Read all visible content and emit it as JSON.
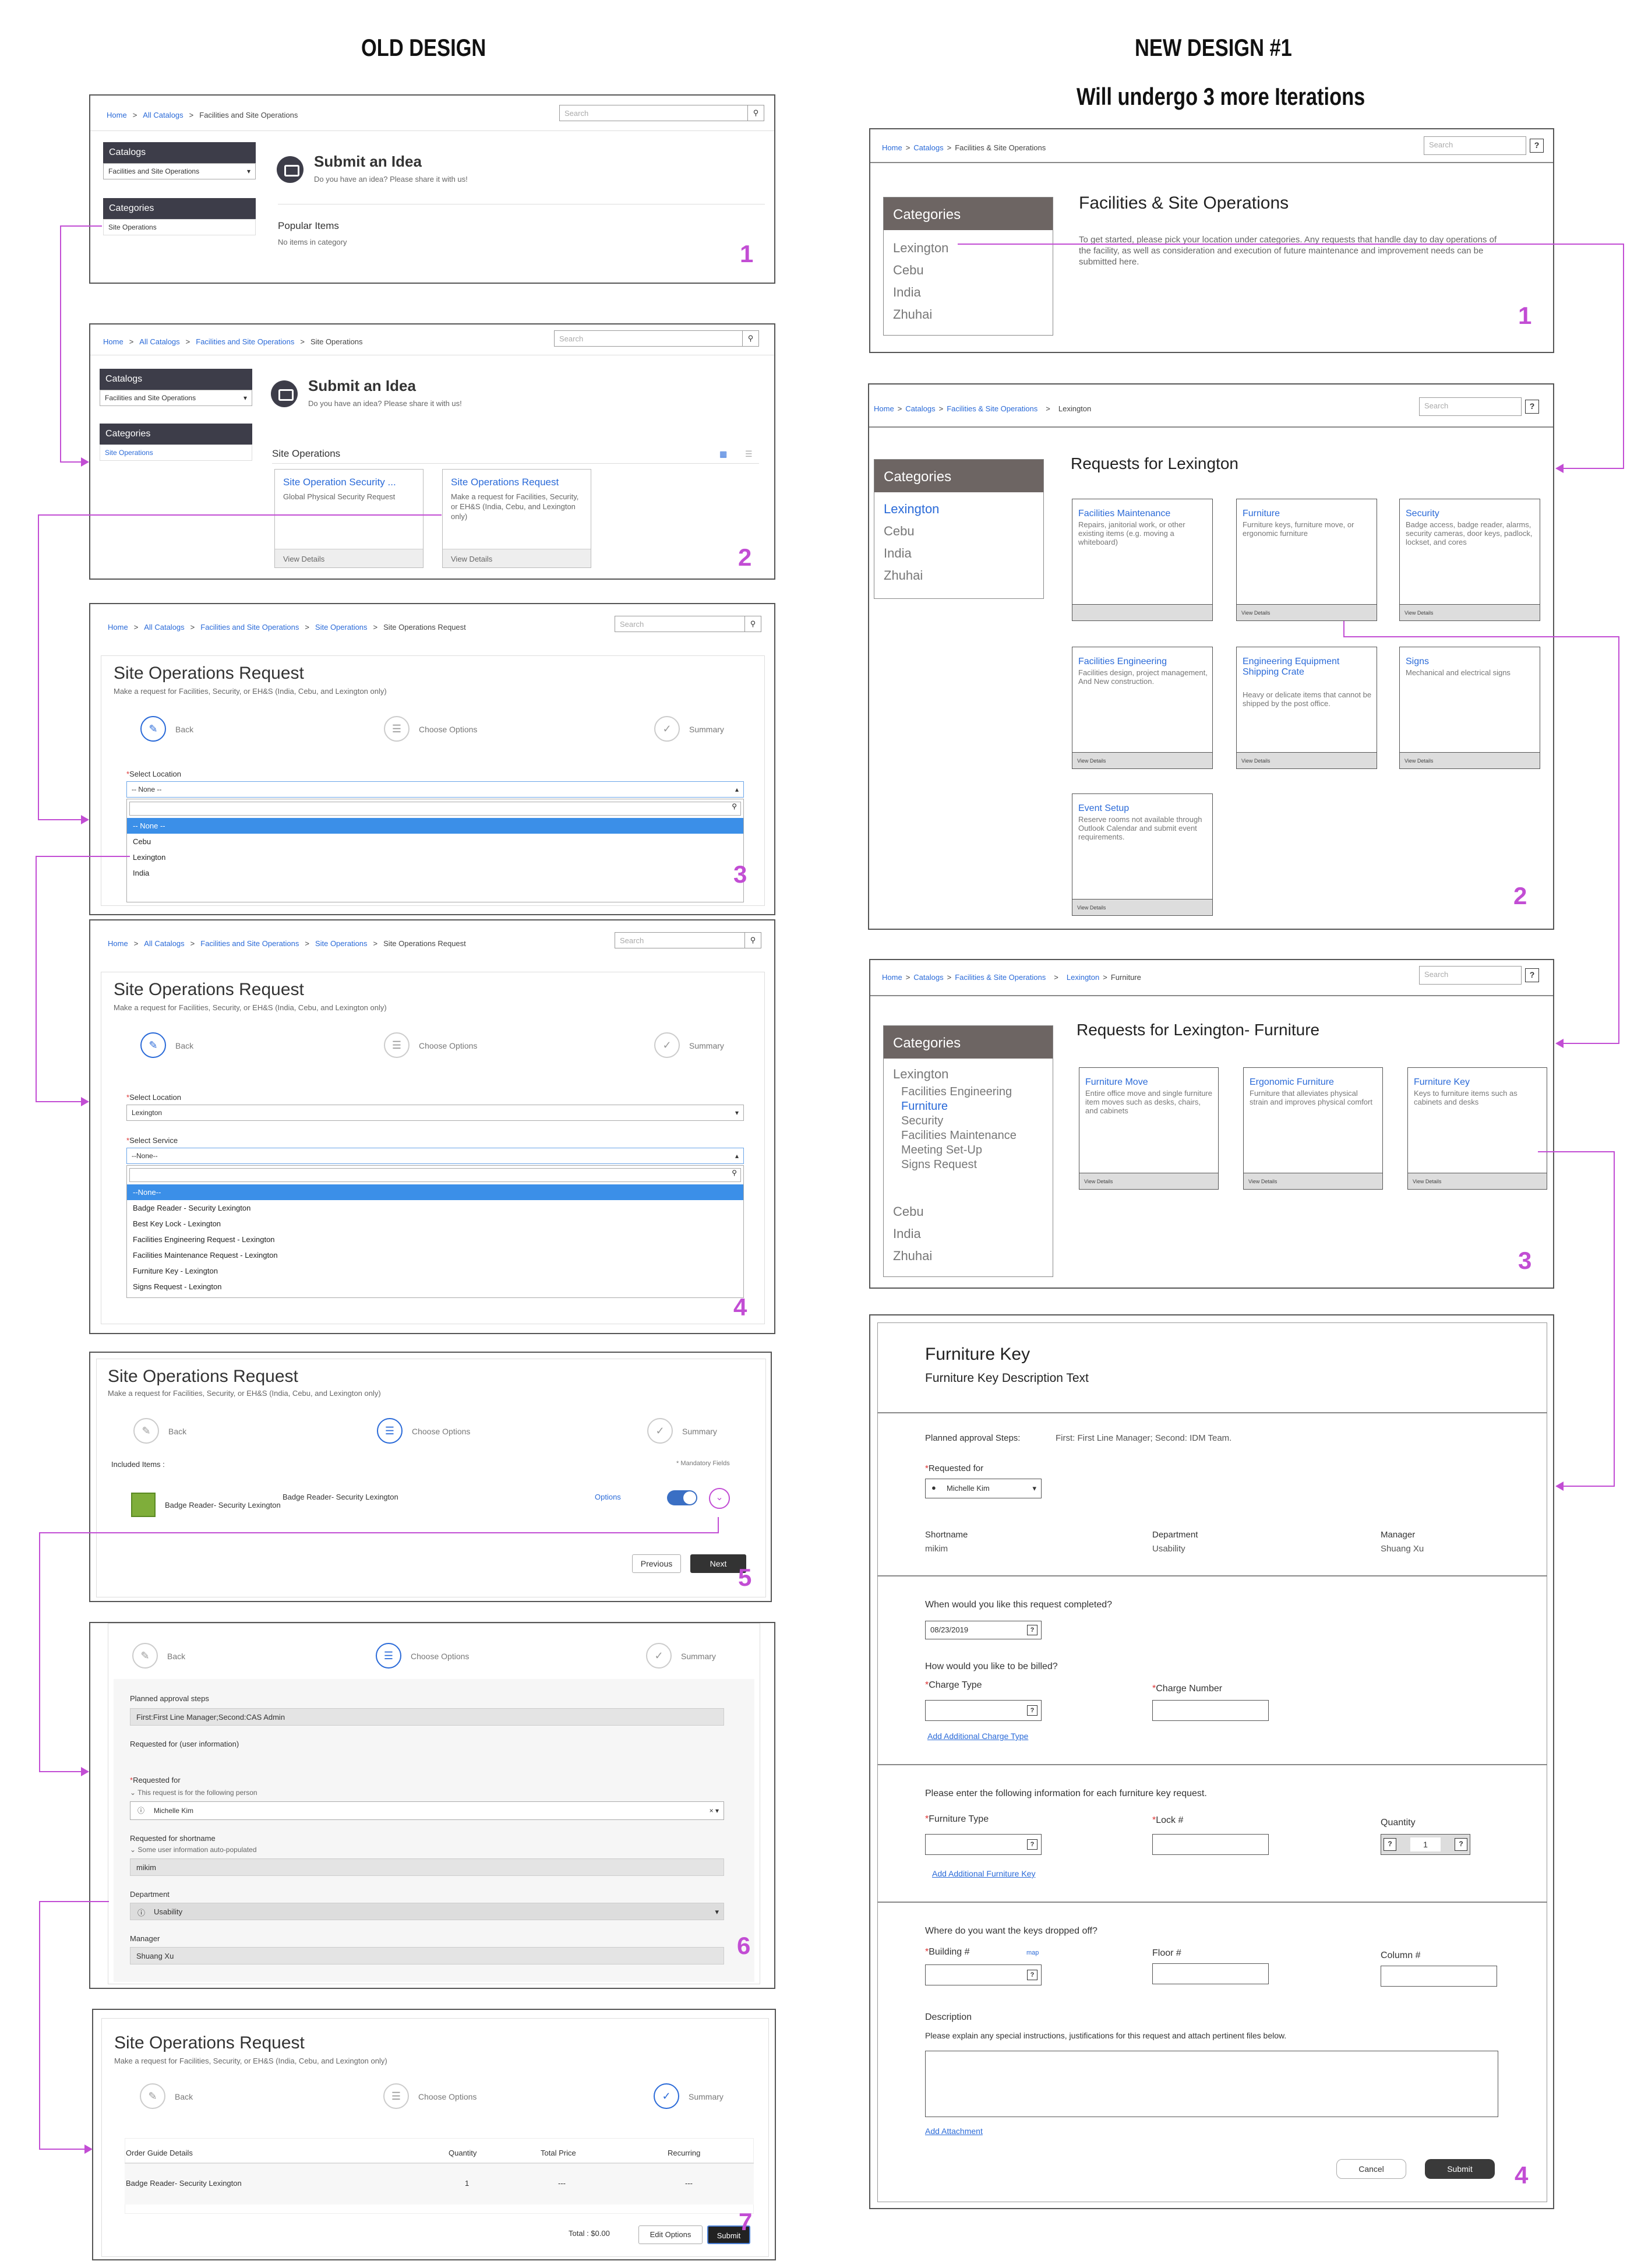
{
  "headings": {
    "old_design": "OLD DESIGN",
    "new_design": "NEW DESIGN #1",
    "iterations_note": "Will undergo 3 more Iterations"
  },
  "old": {
    "s1": {
      "crumbs": [
        "Home",
        "All Catalogs",
        "Facilities and Site Operations"
      ],
      "search": "Search",
      "catalogs_header": "Catalogs",
      "catalog_select": "Facilities and Site Operations",
      "categories_header": "Categories",
      "category_item": "Site Operations",
      "title": "Submit an Idea",
      "subtitle": "Do you have an idea? Please share it with us!",
      "popular": "Popular Items",
      "no_items": "No items in category",
      "step_number": "1"
    },
    "s2": {
      "crumbs": [
        "Home",
        "All Catalogs",
        "Facilities and Site Operations",
        "Site Operations"
      ],
      "search": "Search",
      "catalogs_header": "Catalogs",
      "catalog_select": "Facilities and Site Operations",
      "categories_header": "Categories",
      "category_item": "Site Operations",
      "title": "Submit an Idea",
      "subtitle": "Do you have an idea? Please share it with us!",
      "section": "Site Operations",
      "card1_title": "Site Operation Security ...",
      "card1_desc": "Global Physical Security Request",
      "card1_footer": "View Details",
      "card2_title": "Site Operations Request",
      "card2_desc": "Make a request for Facilities, Security, or EH&S (India, Cebu, and Lexington only)",
      "card2_footer": "View Details",
      "step_number": "2"
    },
    "s3": {
      "crumbs": [
        "Home",
        "All Catalogs",
        "Facilities and Site Operations",
        "Site Operations",
        "Site Operations Request"
      ],
      "search": "Search",
      "title": "Site Operations Request",
      "subtitle": "Make a request for Facilities, Security, or EH&S (India, Cebu, and Lexington only)",
      "steps": [
        "Back",
        "Choose Options",
        "Summary"
      ],
      "location_label": "Select Location",
      "location_value": "-- None --",
      "options": [
        "-- None --",
        "Cebu",
        "Lexington",
        "India"
      ],
      "step_number": "3"
    },
    "s4": {
      "crumbs": [
        "Home",
        "All Catalogs",
        "Facilities and Site Operations",
        "Site Operations",
        "Site Operations Request"
      ],
      "search": "Search",
      "title": "Site Operations Request",
      "subtitle": "Make a request for Facilities, Security, or EH&S (India, Cebu, and Lexington only)",
      "steps": [
        "Back",
        "Choose Options",
        "Summary"
      ],
      "location_label": "Select Location",
      "location_value": "Lexington",
      "service_label": "Select Service",
      "service_value": "--None--",
      "options": [
        "--None--",
        "Badge Reader - Security Lexington",
        "Best Key Lock - Lexington",
        "Facilities Engineering Request - Lexington",
        "Facilities Maintenance Request - Lexington",
        "Furniture Key - Lexington",
        "Signs Request - Lexington"
      ],
      "step_number": "4"
    },
    "s5": {
      "title": "Site Operations Request",
      "subtitle": "Make a request for Facilities, Security, or EH&S (India, Cebu, and Lexington only)",
      "steps": [
        "Back",
        "Choose Options",
        "Summary"
      ],
      "included": "Included Items :",
      "mandatory": "* Mandatory Fields",
      "item_name": "Badge Reader- Security Lexington",
      "item_full": "Badge Reader- Security Lexington",
      "options_link": "Options",
      "previous": "Previous",
      "next": "Next",
      "step_number": "5"
    },
    "s6": {
      "steps": [
        "Back",
        "Choose Options",
        "Summary"
      ],
      "approval_label": "Planned approval steps",
      "approval_value": "First:First Line Manager;Second:CAS Admin",
      "requested_for_info": "Requested for (user information)",
      "requested_for_label": "Requested for",
      "requested_for_hint": "This request is for the following person",
      "requested_for_value": "Michelle Kim",
      "shortname_label": "Requested for shortname",
      "shortname_hint": "Some user information auto-populated",
      "shortname_value": "mikim",
      "department_label": "Department",
      "department_value": "Usability",
      "manager_label": "Manager",
      "manager_value": "Shuang Xu",
      "step_number": "6"
    },
    "s7": {
      "title": "Site Operations Request",
      "subtitle": "Make a request for Facilities, Security, or EH&S (India, Cebu, and Lexington only)",
      "steps": [
        "Back",
        "Choose Options",
        "Summary"
      ],
      "columns": [
        "Order Guide Details",
        "Quantity",
        "Total Price",
        "Recurring"
      ],
      "row": [
        "Badge Reader- Security Lexington",
        "1",
        "---",
        "---"
      ],
      "total": "Total : $0.00",
      "edit": "Edit Options",
      "submit": "Submit",
      "step_number": "7"
    }
  },
  "new": {
    "s1": {
      "crumbs": [
        "Home",
        "Catalogs",
        "Facilities & Site Operations"
      ],
      "search": "Search",
      "categories_header": "Categories",
      "categories": [
        "Lexington",
        "Cebu",
        "India",
        "Zhuhai"
      ],
      "title": "Facilities & Site Operations",
      "desc": "To get started, please pick your location under categories. Any requests that handle day to day operations of the facility, as well as consideration and execution of future maintenance and improvement needs can be submitted here.",
      "step_number": "1"
    },
    "s2": {
      "crumbs": [
        "Home",
        "Catalogs",
        "Facilities & Site Operations",
        "Lexington"
      ],
      "search": "Search",
      "categories_header": "Categories",
      "categories": [
        "Lexington",
        "Cebu",
        "India",
        "Zhuhai"
      ],
      "title": "Requests for Lexington",
      "cards": [
        {
          "title": "Facilities Maintenance",
          "desc": "Repairs, janitorial work, or other existing items (e.g. moving a whiteboard)",
          "footer": ""
        },
        {
          "title": "Furniture",
          "desc": "Furniture keys, furniture move, or ergonomic furniture",
          "footer": "View Details"
        },
        {
          "title": "Security",
          "desc": "Badge access, badge reader, alarms, security cameras, door keys, padlock, lockset, and cores",
          "footer": "View Details"
        },
        {
          "title": "Facilities Engineering",
          "desc": "Facilities design, project management, And New construction.",
          "footer": "View Details"
        },
        {
          "title": "Engineering Equipment Shipping Crate",
          "desc": "Heavy or delicate items that cannot be shipped by the post office.",
          "footer": "View Details"
        },
        {
          "title": "Signs",
          "desc": "Mechanical and electrical signs",
          "footer": "View Details"
        },
        {
          "title": "Event Setup",
          "desc": "Reserve rooms not available through Outlook Calendar and submit event requirements.",
          "footer": "View Details"
        }
      ],
      "step_number": "2"
    },
    "s3": {
      "crumbs": [
        "Home",
        "Catalogs",
        "Facilities & Site Operations",
        "Lexington",
        "Furniture"
      ],
      "search": "Search",
      "categories_header": "Categories",
      "categories": [
        "Lexington",
        "Cebu",
        "India",
        "Zhuhai"
      ],
      "subcategories": [
        "Facilities Engineering",
        "Furniture",
        "Security",
        "Facilities Maintenance",
        "Meeting Set-Up",
        "Signs Request"
      ],
      "title": "Requests for Lexington- Furniture",
      "cards": [
        {
          "title": "Furniture Move",
          "desc": "Entire office move and single furniture item moves such as desks, chairs, and cabinets",
          "footer": "View Details"
        },
        {
          "title": "Ergonomic Furniture",
          "desc": "Furniture that alleviates physical strain and improves physical comfort",
          "footer": "View Details"
        },
        {
          "title": "Furniture Key",
          "desc": "Keys to furniture items such as cabinets and desks",
          "footer": "View Details"
        }
      ],
      "step_number": "3"
    },
    "s4": {
      "title": "Furniture Key",
      "subtitle": "Furniture Key Description Text",
      "approval_label": "Planned approval Steps:",
      "approval_value": "First: First Line Manager; Second: IDM Team.",
      "requested_for_label": "Requested for",
      "requested_for_value": "Michelle Kim",
      "shortname_label": "Shortname",
      "shortname_value": "mikim",
      "department_label": "Department",
      "department_value": "Usability",
      "manager_label": "Manager",
      "manager_value": "Shuang Xu",
      "when_label": "When would you like this request completed?",
      "date_value": "08/23/2019",
      "billed_label": "How would you like to be billed?",
      "charge_type_label": "Charge Type",
      "charge_number_label": "Charge Number",
      "add_charge": "Add Additional Charge Type",
      "furniture_info": "Please enter the following information for each furniture key request.",
      "furniture_type_label": "Furniture Type",
      "lock_label": "Lock #",
      "quantity_label": "Quantity",
      "quantity_value": "1",
      "add_key": "Add Additional Furniture Key",
      "dropped_label": "Where do you want the keys dropped off?",
      "building_label": "Building #",
      "map_link": "map",
      "floor_label": "Floor #",
      "column_label": "Column #",
      "description_label": "Description",
      "description_hint": "Please explain any special instructions,  justifications for this request and attach pertinent files below.",
      "add_attachment": "Add Attachment",
      "cancel": "Cancel",
      "submit": "Submit",
      "step_number": "4"
    }
  },
  "colors": {
    "annotation": "#c24dd4",
    "link": "#2a6ad8",
    "category_header": "#6d6563",
    "dark_bar": "#3d3d49"
  }
}
